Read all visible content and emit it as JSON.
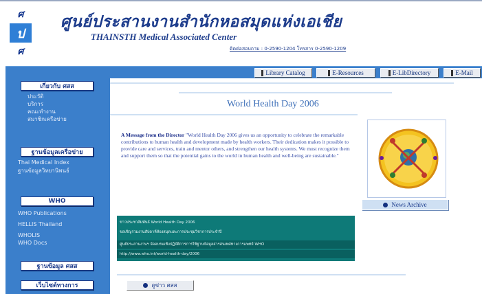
{
  "header": {
    "logo_letters": [
      "ศ",
      "ป",
      "ศ"
    ],
    "title_thai": "ศูนย์ประสานงานสำนักหอสมุดแห่งเอเชีย",
    "title_english": "THAINSTH Medical Associated Center",
    "contact": "ติดต่อสอบถาม : 0-2590-1204 โทรสาร 0-2590-1209"
  },
  "toolbar": {
    "items": [
      "Library Catalog",
      "E-Resources",
      "E-LibDirectory",
      "E-Mail"
    ]
  },
  "sidebar": {
    "sections": [
      {
        "heading": "เกี่ยวกับ ศสส",
        "links": [
          "ประวัติ",
          "บริการ",
          "คณะทำงาน",
          "สมาชิกเครือข่าย"
        ]
      },
      {
        "heading": "ฐานข้อมูลเครือข่าย",
        "links": [
          "Thai Medical Index",
          "ฐานข้อมูลวิทยานิพนธ์"
        ]
      },
      {
        "heading": "WHO",
        "links": [
          "WHO Publications",
          "HELLIS Thailand",
          "WHOLIS",
          "WHO Docs"
        ]
      },
      {
        "heading": "ฐานข้อมูล ศสส",
        "links": []
      },
      {
        "heading": "เว็บไซต์ทางการ",
        "links": []
      }
    ]
  },
  "main": {
    "title": "World Health Day 2006",
    "intro_lead": "A Message from the Director",
    "intro_body": "\"World Health Day 2006 gives us an opportunity to celebrate the remarkable contributions to human health and development made by health workers. Their dedication makes it possible to provide care and services, train and mentor others, and strengthen our health systems. We must recognize them and support them so that the potential gains to the world in human health and well-being are sustainable.\"",
    "news_archive": "News Archive",
    "news_items": [
      "ข่าวประชาสัมพันธ์ World Health Day 2006",
      "ขอเชิญร่วมงานสัปดาห์ห้องสมุดและการประชุมวิชาการประจำปี",
      "ศูนย์ประสานงานฯ จัดอบรมเชิงปฏิบัติการการใช้ฐานข้อมูลสารสนเทศทางการแพทย์ WHO",
      "http://www.who.int/world-health-day/2006"
    ],
    "bottom_link": "ดูข่าว ศสส"
  },
  "colors": {
    "sidebar_blue": "#3b7fcb",
    "news_teal": "#0e7a78",
    "title_blue": "#3d6fb8",
    "header_navy": "#1d3c8c"
  }
}
